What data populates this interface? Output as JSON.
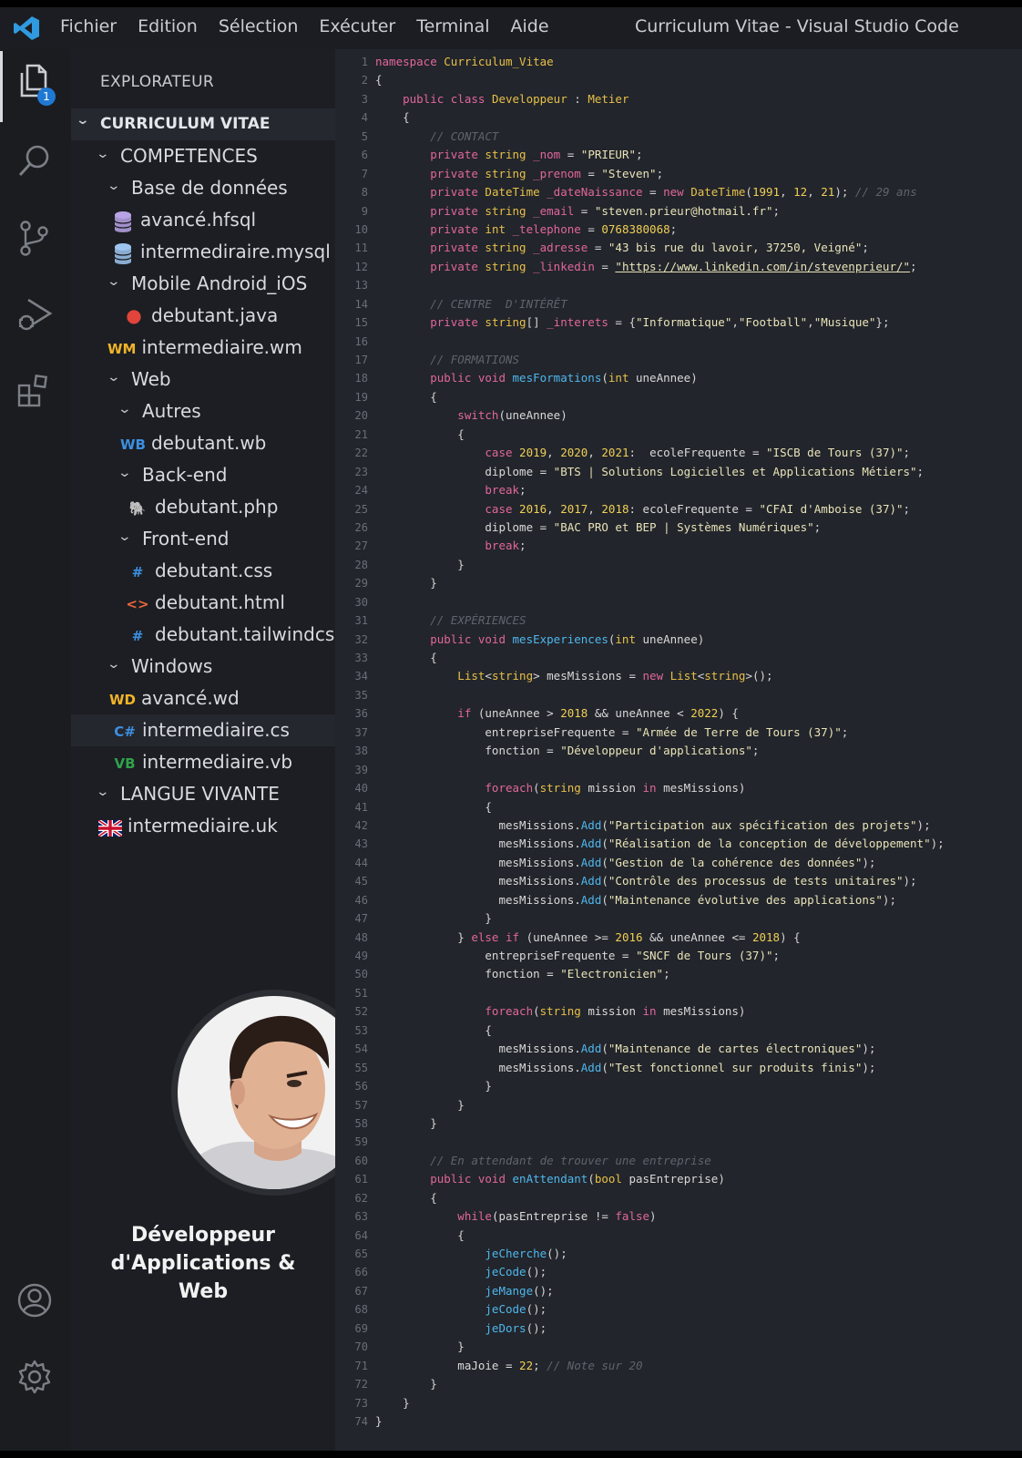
{
  "titlebar": {
    "menu": [
      "Fichier",
      "Edition",
      "Sélection",
      "Exécuter",
      "Terminal",
      "Aide"
    ],
    "title": "Curriculum Vitae - Visual Studio Code"
  },
  "activity_bar": {
    "explorer_badge": "1",
    "items": [
      "files-icon",
      "search-icon",
      "source-control-icon",
      "run-debug-icon",
      "extensions-icon",
      "account-icon",
      "settings-gear-icon"
    ]
  },
  "sidebar": {
    "title": "EXPLORATEUR",
    "tree": [
      {
        "label": "CURRICULUM VITAE",
        "type": "head"
      },
      {
        "label": "COMPETENCES",
        "type": "folder"
      },
      {
        "label": "Base de données",
        "type": "folder"
      },
      {
        "label": "avancé.hfsql",
        "type": "file",
        "icon": "database-icon",
        "glyph": "",
        "color": "#b9a3e6"
      },
      {
        "label": "intermediraire.mysql",
        "type": "file",
        "icon": "database-icon",
        "glyph": "",
        "color": "#9ec5f0"
      },
      {
        "label": "Mobile Android_iOS",
        "type": "folder"
      },
      {
        "label": "debutant.java",
        "type": "file",
        "icon": "java-icon",
        "glyph": "●",
        "color": "#e0443b"
      },
      {
        "label": "intermediaire.wm",
        "type": "file",
        "icon": "wm-icon",
        "glyph": "WM",
        "color": "#f0b429"
      },
      {
        "label": "Web",
        "type": "folder"
      },
      {
        "label": "Autres",
        "type": "folder"
      },
      {
        "label": "debutant.wb",
        "type": "file",
        "icon": "wb-icon",
        "glyph": "WB",
        "color": "#3c8fe0"
      },
      {
        "label": "Back-end",
        "type": "folder"
      },
      {
        "label": "debutant.php",
        "type": "file",
        "icon": "php-elephant-icon",
        "glyph": "🐘",
        "color": "#a48ad8"
      },
      {
        "label": "Front-end",
        "type": "folder"
      },
      {
        "label": "debutant.css",
        "type": "file",
        "icon": "css-hash-icon",
        "glyph": "#",
        "color": "#3c8fe0"
      },
      {
        "label": "debutant.html",
        "type": "file",
        "icon": "html-icon",
        "glyph": "<>",
        "color": "#e8683a"
      },
      {
        "label": "debutant.tailwindcss",
        "type": "file",
        "icon": "css-hash-icon",
        "glyph": "#",
        "color": "#3c8fe0"
      },
      {
        "label": "Windows",
        "type": "folder"
      },
      {
        "label": "avancé.wd",
        "type": "file",
        "icon": "wd-icon",
        "glyph": "WD",
        "color": "#f0b429"
      },
      {
        "label": "intermediaire.cs",
        "type": "file",
        "icon": "csharp-icon",
        "glyph": "C#",
        "color": "#3c8fe0"
      },
      {
        "label": "intermediaire.vb",
        "type": "file",
        "icon": "vb-icon",
        "glyph": "VB",
        "color": "#2fa24a"
      },
      {
        "label": "LANGUE VIVANTE",
        "type": "folder"
      },
      {
        "label": "intermediaire.uk",
        "type": "file",
        "icon": "uk-flag-icon",
        "glyph": "",
        "color": "#c8102e"
      }
    ],
    "caption": [
      "Développeur",
      "d'Applications &",
      "Web"
    ]
  },
  "editor": {
    "line_count": 74,
    "lines": [
      [
        [
          "namespace ",
          "kw"
        ],
        [
          "Curriculum_Vitae",
          "ty"
        ]
      ],
      [
        [
          "{",
          "pn"
        ]
      ],
      [
        [
          "    public class ",
          "kw"
        ],
        [
          "Developpeur",
          "ty"
        ],
        [
          " : ",
          "op"
        ],
        [
          "Metier",
          "ty"
        ]
      ],
      [
        [
          "    {",
          "pn"
        ]
      ],
      [
        [
          "        // CONTACT",
          "cm"
        ]
      ],
      [
        [
          "        private ",
          "kw"
        ],
        [
          "string ",
          "ty"
        ],
        [
          "_nom",
          "fd"
        ],
        [
          " = ",
          "op"
        ],
        [
          "\"PRIEUR\"",
          "st"
        ],
        [
          ";",
          "pn"
        ]
      ],
      [
        [
          "        private ",
          "kw"
        ],
        [
          "string ",
          "ty"
        ],
        [
          "_prenom",
          "fd"
        ],
        [
          " = ",
          "op"
        ],
        [
          "\"Steven\"",
          "st"
        ],
        [
          ";",
          "pn"
        ]
      ],
      [
        [
          "        private ",
          "kw"
        ],
        [
          "DateTime ",
          "ty"
        ],
        [
          "_dateNaissance",
          "fd"
        ],
        [
          " = ",
          "op"
        ],
        [
          "new ",
          "kw"
        ],
        [
          "DateTime",
          "ty"
        ],
        [
          "(",
          "pn"
        ],
        [
          "1991",
          "nu"
        ],
        [
          ", ",
          "pn"
        ],
        [
          "12",
          "nu"
        ],
        [
          ", ",
          "pn"
        ],
        [
          "21",
          "nu"
        ],
        [
          "); ",
          "pn"
        ],
        [
          "// 29 ans",
          "cm"
        ]
      ],
      [
        [
          "        private ",
          "kw"
        ],
        [
          "string ",
          "ty"
        ],
        [
          "_email",
          "fd"
        ],
        [
          " = ",
          "op"
        ],
        [
          "\"steven.prieur@hotmail.fr\"",
          "st"
        ],
        [
          ";",
          "pn"
        ]
      ],
      [
        [
          "        private ",
          "kw"
        ],
        [
          "int ",
          "ty"
        ],
        [
          "_telephone",
          "fd"
        ],
        [
          " = ",
          "op"
        ],
        [
          "0768380068",
          "nu"
        ],
        [
          ";",
          "pn"
        ]
      ],
      [
        [
          "        private ",
          "kw"
        ],
        [
          "string ",
          "ty"
        ],
        [
          "_adresse",
          "fd"
        ],
        [
          " = ",
          "op"
        ],
        [
          "\"43 bis rue du lavoir, 37250, Veigné\"",
          "st"
        ],
        [
          ";",
          "pn"
        ]
      ],
      [
        [
          "        private ",
          "kw"
        ],
        [
          "string ",
          "ty"
        ],
        [
          "_linkedin",
          "fd"
        ],
        [
          " = ",
          "op"
        ],
        [
          "\"https://www.linkedin.com/in/stevenprieur/\"",
          "ul"
        ],
        [
          ";",
          "pn"
        ]
      ],
      [],
      [
        [
          "        // CENTRE  D'INTÉRÊT",
          "cm"
        ]
      ],
      [
        [
          "        private ",
          "kw"
        ],
        [
          "string",
          "ty"
        ],
        [
          "[] ",
          "pn"
        ],
        [
          "_interets",
          "fd"
        ],
        [
          " = ",
          "op"
        ],
        [
          "{",
          "pn"
        ],
        [
          "\"Informatique\"",
          "st"
        ],
        [
          ",",
          "pn"
        ],
        [
          "\"Football\"",
          "st"
        ],
        [
          ",",
          "pn"
        ],
        [
          "\"Musique\"",
          "st"
        ],
        [
          "};",
          "pn"
        ]
      ],
      [],
      [
        [
          "        // FORMATIONS",
          "cm"
        ]
      ],
      [
        [
          "        public void ",
          "kw"
        ],
        [
          "mesFormations",
          "fn"
        ],
        [
          "(",
          "pn"
        ],
        [
          "int ",
          "ty"
        ],
        [
          "uneAnnee",
          "id"
        ],
        [
          ")",
          "pn"
        ]
      ],
      [
        [
          "        {",
          "pn"
        ]
      ],
      [
        [
          "            switch",
          "kw"
        ],
        [
          "(uneAnnee)",
          "id"
        ]
      ],
      [
        [
          "            {",
          "pn"
        ]
      ],
      [
        [
          "                case ",
          "kw"
        ],
        [
          "2019",
          "nu"
        ],
        [
          ", ",
          "pn"
        ],
        [
          "2020",
          "nu"
        ],
        [
          ", ",
          "pn"
        ],
        [
          "2021",
          "nu"
        ],
        [
          ":  ecoleFrequente = ",
          "id"
        ],
        [
          "\"ISCB de Tours (37)\"",
          "st"
        ],
        [
          ";",
          "pn"
        ]
      ],
      [
        [
          "                diplome = ",
          "id"
        ],
        [
          "\"BTS | Solutions Logicielles et Applications Métiers\"",
          "st"
        ],
        [
          ";",
          "pn"
        ]
      ],
      [
        [
          "                break",
          "kw"
        ],
        [
          ";",
          "pn"
        ]
      ],
      [
        [
          "                case ",
          "kw"
        ],
        [
          "2016",
          "nu"
        ],
        [
          ", ",
          "pn"
        ],
        [
          "2017",
          "nu"
        ],
        [
          ", ",
          "pn"
        ],
        [
          "2018",
          "nu"
        ],
        [
          ": ecoleFrequente = ",
          "id"
        ],
        [
          "\"CFAI d'Amboise (37)\"",
          "st"
        ],
        [
          ";",
          "pn"
        ]
      ],
      [
        [
          "                diplome = ",
          "id"
        ],
        [
          "\"BAC PRO et BEP | Systèmes Numériques\"",
          "st"
        ],
        [
          ";",
          "pn"
        ]
      ],
      [
        [
          "                break",
          "kw"
        ],
        [
          ";",
          "pn"
        ]
      ],
      [
        [
          "            }",
          "pn"
        ]
      ],
      [
        [
          "        }",
          "pn"
        ]
      ],
      [],
      [
        [
          "        // EXPÉRIENCES",
          "cm"
        ]
      ],
      [
        [
          "        public void ",
          "kw"
        ],
        [
          "mesExperiences",
          "fn"
        ],
        [
          "(",
          "pn"
        ],
        [
          "int ",
          "ty"
        ],
        [
          "uneAnnee",
          "id"
        ],
        [
          ")",
          "pn"
        ]
      ],
      [
        [
          "        {",
          "pn"
        ]
      ],
      [
        [
          "            List",
          "ty"
        ],
        [
          "<",
          "pn"
        ],
        [
          "string",
          "ty"
        ],
        [
          "> mesMissions = ",
          "id"
        ],
        [
          "new ",
          "kw"
        ],
        [
          "List",
          "ty"
        ],
        [
          "<",
          "pn"
        ],
        [
          "string",
          "ty"
        ],
        [
          ">();",
          "pn"
        ]
      ],
      [],
      [
        [
          "            if ",
          "kw"
        ],
        [
          "(uneAnnee > ",
          "id"
        ],
        [
          "2018",
          "nu"
        ],
        [
          " && uneAnnee < ",
          "id"
        ],
        [
          "2022",
          "nu"
        ],
        [
          ") {",
          "pn"
        ]
      ],
      [
        [
          "                entrepriseFrequente = ",
          "id"
        ],
        [
          "\"Armée de Terre de Tours (37)\"",
          "st"
        ],
        [
          ";",
          "pn"
        ]
      ],
      [
        [
          "                fonction = ",
          "id"
        ],
        [
          "\"Développeur d'applications\"",
          "st"
        ],
        [
          ";",
          "pn"
        ]
      ],
      [],
      [
        [
          "                foreach",
          "kw"
        ],
        [
          "(",
          "pn"
        ],
        [
          "string ",
          "ty"
        ],
        [
          "mission ",
          "id"
        ],
        [
          "in ",
          "kw"
        ],
        [
          "mesMissions)",
          "id"
        ]
      ],
      [
        [
          "                {",
          "pn"
        ]
      ],
      [
        [
          "                  mesMissions.",
          "id"
        ],
        [
          "Add",
          "fn"
        ],
        [
          "(",
          "pn"
        ],
        [
          "\"Participation aux spécification des projets\"",
          "st"
        ],
        [
          ");",
          "pn"
        ]
      ],
      [
        [
          "                  mesMissions.",
          "id"
        ],
        [
          "Add",
          "fn"
        ],
        [
          "(",
          "pn"
        ],
        [
          "\"Réalisation de la conception de développement\"",
          "st"
        ],
        [
          ");",
          "pn"
        ]
      ],
      [
        [
          "                  mesMissions.",
          "id"
        ],
        [
          "Add",
          "fn"
        ],
        [
          "(",
          "pn"
        ],
        [
          "\"Gestion de la cohérence des données\"",
          "st"
        ],
        [
          ");",
          "pn"
        ]
      ],
      [
        [
          "                  mesMissions.",
          "id"
        ],
        [
          "Add",
          "fn"
        ],
        [
          "(",
          "pn"
        ],
        [
          "\"Contrôle des processus de tests unitaires\"",
          "st"
        ],
        [
          ");",
          "pn"
        ]
      ],
      [
        [
          "                  mesMissions.",
          "id"
        ],
        [
          "Add",
          "fn"
        ],
        [
          "(",
          "pn"
        ],
        [
          "\"Maintenance évolutive des applications\"",
          "st"
        ],
        [
          ");",
          "pn"
        ]
      ],
      [
        [
          "                }",
          "pn"
        ]
      ],
      [
        [
          "            } ",
          "pn"
        ],
        [
          "else if ",
          "kw"
        ],
        [
          "(uneAnnee >= ",
          "id"
        ],
        [
          "2016",
          "nu"
        ],
        [
          " && uneAnnee <= ",
          "id"
        ],
        [
          "2018",
          "nu"
        ],
        [
          ") {",
          "pn"
        ]
      ],
      [
        [
          "                entrepriseFrequente = ",
          "id"
        ],
        [
          "\"SNCF de Tours (37)\"",
          "st"
        ],
        [
          ";",
          "pn"
        ]
      ],
      [
        [
          "                fonction = ",
          "id"
        ],
        [
          "\"Electronicien\"",
          "st"
        ],
        [
          ";",
          "pn"
        ]
      ],
      [],
      [
        [
          "                foreach",
          "kw"
        ],
        [
          "(",
          "pn"
        ],
        [
          "string ",
          "ty"
        ],
        [
          "mission ",
          "id"
        ],
        [
          "in ",
          "kw"
        ],
        [
          "mesMissions)",
          "id"
        ]
      ],
      [
        [
          "                {",
          "pn"
        ]
      ],
      [
        [
          "                  mesMissions.",
          "id"
        ],
        [
          "Add",
          "fn"
        ],
        [
          "(",
          "pn"
        ],
        [
          "\"Maintenance de cartes électroniques\"",
          "st"
        ],
        [
          ");",
          "pn"
        ]
      ],
      [
        [
          "                  mesMissions.",
          "id"
        ],
        [
          "Add",
          "fn"
        ],
        [
          "(",
          "pn"
        ],
        [
          "\"Test fonctionnel sur produits finis\"",
          "st"
        ],
        [
          ");",
          "pn"
        ]
      ],
      [
        [
          "                }",
          "pn"
        ]
      ],
      [
        [
          "            }",
          "pn"
        ]
      ],
      [
        [
          "        }",
          "pn"
        ]
      ],
      [],
      [
        [
          "        // En attendant de trouver une entreprise",
          "cm"
        ]
      ],
      [
        [
          "        public void ",
          "kw"
        ],
        [
          "enAttendant",
          "fn"
        ],
        [
          "(",
          "pn"
        ],
        [
          "bool ",
          "ty"
        ],
        [
          "pasEntreprise",
          "id"
        ],
        [
          ")",
          "pn"
        ]
      ],
      [
        [
          "        {",
          "pn"
        ]
      ],
      [
        [
          "            while",
          "kw"
        ],
        [
          "(pasEntreprise != ",
          "id"
        ],
        [
          "false",
          "kw"
        ],
        [
          ")",
          "pn"
        ]
      ],
      [
        [
          "            {",
          "pn"
        ]
      ],
      [
        [
          "                jeCherche",
          "fn"
        ],
        [
          "();",
          "pn"
        ]
      ],
      [
        [
          "                jeCode",
          "fn"
        ],
        [
          "();",
          "pn"
        ]
      ],
      [
        [
          "                jeMange",
          "fn"
        ],
        [
          "();",
          "pn"
        ]
      ],
      [
        [
          "                jeCode",
          "fn"
        ],
        [
          "();",
          "pn"
        ]
      ],
      [
        [
          "                jeDors",
          "fn"
        ],
        [
          "();",
          "pn"
        ]
      ],
      [
        [
          "            }",
          "pn"
        ]
      ],
      [
        [
          "            maJoie = ",
          "id"
        ],
        [
          "22",
          "nu"
        ],
        [
          "; ",
          "pn"
        ],
        [
          "// Note sur 20",
          "cm"
        ]
      ],
      [
        [
          "        }",
          "pn"
        ]
      ],
      [
        [
          "    }",
          "pn"
        ]
      ],
      [
        [
          "}",
          "pn"
        ]
      ]
    ]
  }
}
